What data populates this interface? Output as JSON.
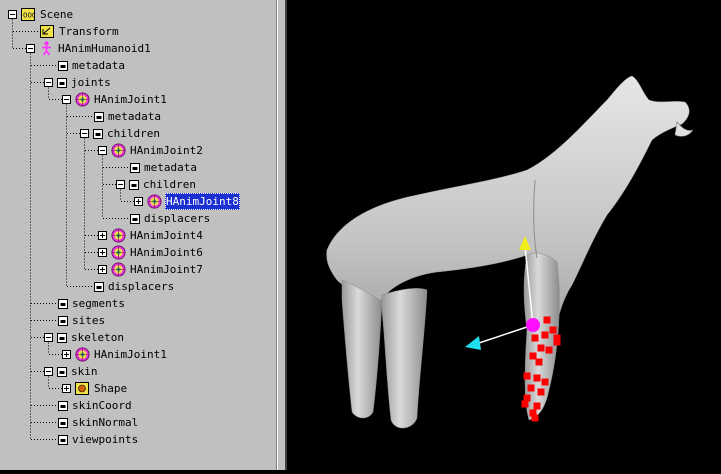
{
  "scene_tree": {
    "nodes": [
      {
        "id": "n0",
        "label": "Scene",
        "icon": "scene-icon",
        "depth": 0,
        "expander": "minus",
        "selected": false
      },
      {
        "id": "n1",
        "label": "Transform",
        "icon": "transform-icon",
        "depth": 1,
        "expander": "none",
        "selected": false
      },
      {
        "id": "n2",
        "label": "HAnimHumanoid1",
        "icon": "humanoid-icon",
        "depth": 1,
        "expander": "minus",
        "selected": false
      },
      {
        "id": "n3",
        "label": "metadata",
        "icon": "field-icon",
        "depth": 2,
        "expander": "none",
        "selected": false
      },
      {
        "id": "n4",
        "label": "joints",
        "icon": "field-icon",
        "depth": 2,
        "expander": "minus",
        "selected": false
      },
      {
        "id": "n5",
        "label": "HAnimJoint1",
        "icon": "joint-icon",
        "depth": 3,
        "expander": "minus",
        "selected": false
      },
      {
        "id": "n6",
        "label": "metadata",
        "icon": "field-icon",
        "depth": 4,
        "expander": "none",
        "selected": false
      },
      {
        "id": "n7",
        "label": "children",
        "icon": "field-icon",
        "depth": 4,
        "expander": "minus",
        "selected": false
      },
      {
        "id": "n8",
        "label": "HAnimJoint2",
        "icon": "joint-icon",
        "depth": 5,
        "expander": "minus",
        "selected": false
      },
      {
        "id": "n9",
        "label": "metadata",
        "icon": "field-icon",
        "depth": 6,
        "expander": "none",
        "selected": false
      },
      {
        "id": "n10",
        "label": "children",
        "icon": "field-icon",
        "depth": 6,
        "expander": "minus",
        "selected": false
      },
      {
        "id": "n11",
        "label": "HAnimJoint8",
        "icon": "joint-icon",
        "depth": 7,
        "expander": "plus",
        "selected": true
      },
      {
        "id": "n12",
        "label": "displacers",
        "icon": "field-icon",
        "depth": 6,
        "expander": "none",
        "selected": false
      },
      {
        "id": "n13",
        "label": "HAnimJoint4",
        "icon": "joint-icon",
        "depth": 5,
        "expander": "plus",
        "selected": false
      },
      {
        "id": "n14",
        "label": "HAnimJoint6",
        "icon": "joint-icon",
        "depth": 5,
        "expander": "plus",
        "selected": false
      },
      {
        "id": "n15",
        "label": "HAnimJoint7",
        "icon": "joint-icon",
        "depth": 5,
        "expander": "plus",
        "selected": false
      },
      {
        "id": "n16",
        "label": "displacers",
        "icon": "field-icon",
        "depth": 4,
        "expander": "none",
        "selected": false
      },
      {
        "id": "n17",
        "label": "segments",
        "icon": "field-icon",
        "depth": 2,
        "expander": "none",
        "selected": false
      },
      {
        "id": "n18",
        "label": "sites",
        "icon": "field-icon",
        "depth": 2,
        "expander": "none",
        "selected": false
      },
      {
        "id": "n19",
        "label": "skeleton",
        "icon": "field-icon",
        "depth": 2,
        "expander": "minus",
        "selected": false
      },
      {
        "id": "n20",
        "label": "HAnimJoint1",
        "icon": "joint-icon",
        "depth": 3,
        "expander": "plus",
        "selected": false
      },
      {
        "id": "n21",
        "label": "skin",
        "icon": "field-icon",
        "depth": 2,
        "expander": "minus",
        "selected": false
      },
      {
        "id": "n22",
        "label": "Shape",
        "icon": "shape-icon",
        "depth": 3,
        "expander": "plus",
        "selected": false
      },
      {
        "id": "n23",
        "label": "skinCoord",
        "icon": "field-icon",
        "depth": 2,
        "expander": "none",
        "selected": false
      },
      {
        "id": "n24",
        "label": "skinNormal",
        "icon": "field-icon",
        "depth": 2,
        "expander": "none",
        "selected": false
      },
      {
        "id": "n25",
        "label": "viewpoints",
        "icon": "field-icon",
        "depth": 2,
        "expander": "none",
        "selected": false
      }
    ]
  },
  "viewport": {
    "model": "wolf-mesh",
    "manipulator_colors": {
      "y_axis": "#f2ee1a",
      "z_axis": "#20e0f0",
      "center": "#ff10ff",
      "vertex_handles": "#ff0000",
      "mesh": "#c8c8c8"
    }
  },
  "colors": {
    "panel_bg": "#c0c0c0",
    "selection_bg": "#1c2fd0",
    "viewport_bg": "#000000"
  }
}
